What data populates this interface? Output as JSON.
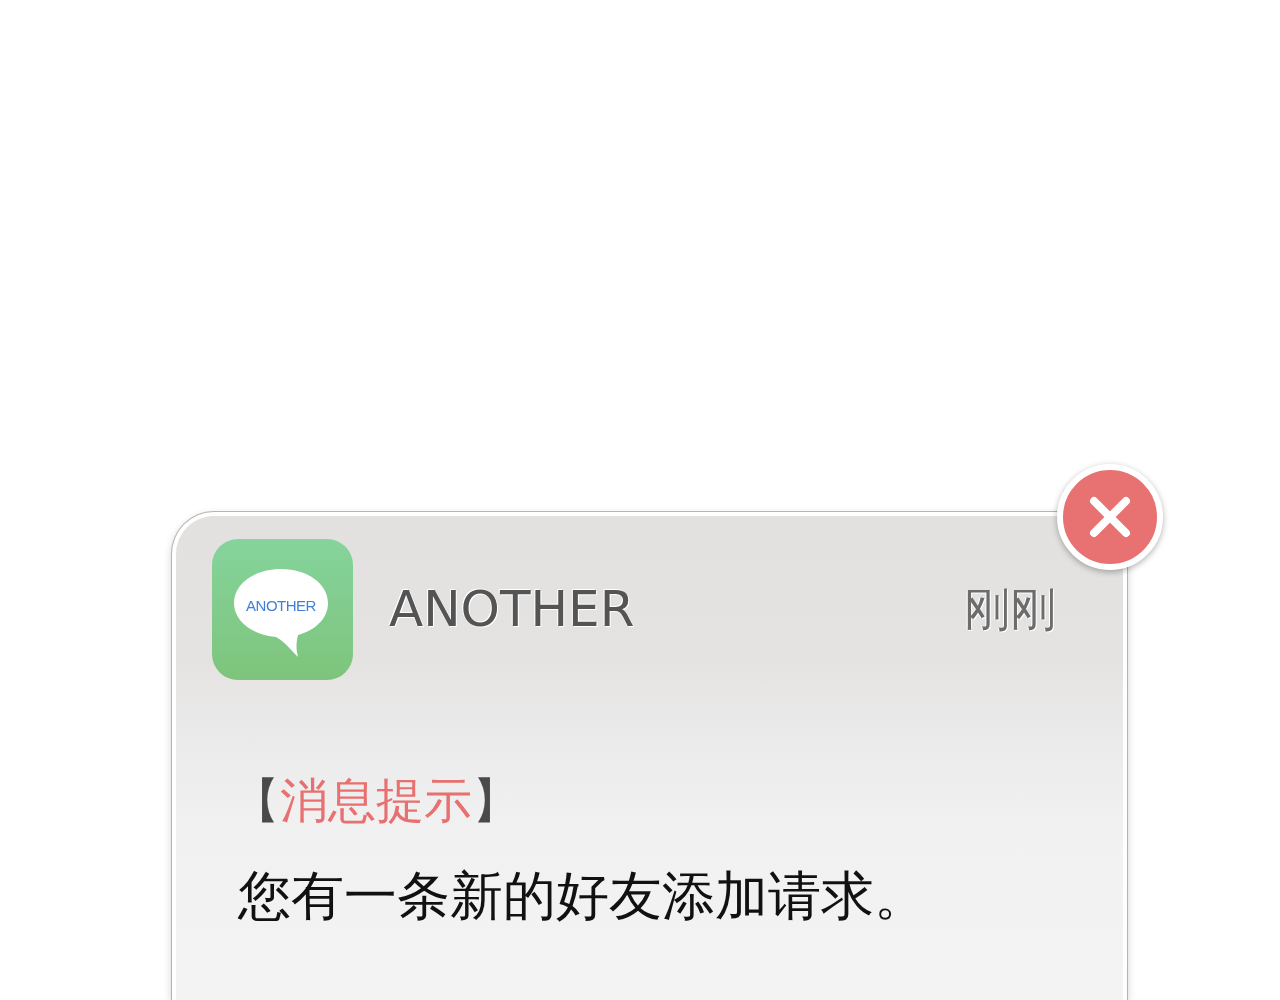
{
  "notification": {
    "app_icon_label": "ANOTHER",
    "app_name": "ANOTHER",
    "time": "刚刚",
    "heading": {
      "open": "【",
      "text": "消息提示",
      "close": "】"
    },
    "message": "您有一条新的好友添加请求。"
  }
}
